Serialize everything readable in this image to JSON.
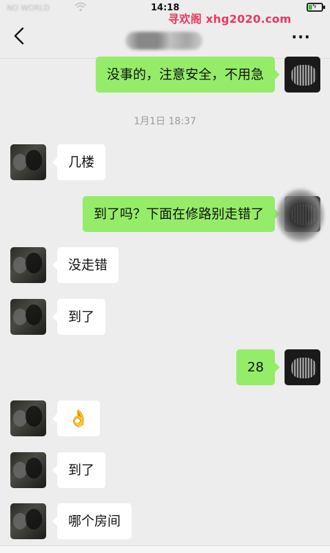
{
  "status_bar": {
    "carrier": "NO WORLD",
    "time": "14:18",
    "watermark": "寻欢阁 xhg2020.com",
    "battery_level": 0.3
  },
  "nav": {
    "back_icon": "chevron-left-icon",
    "more": "···"
  },
  "messages": [
    {
      "sender": "me",
      "text": "没事的，注意安全，不用急"
    },
    {
      "type": "time",
      "text": "1月1日 18:37"
    },
    {
      "sender": "friend",
      "text": "几楼"
    },
    {
      "sender": "me",
      "text": "到了吗？下面在修路别走错了"
    },
    {
      "sender": "friend",
      "text": "没走错"
    },
    {
      "sender": "friend",
      "text": "到了"
    },
    {
      "sender": "me",
      "text": "28"
    },
    {
      "sender": "friend",
      "text": "👌"
    },
    {
      "sender": "friend",
      "text": "到了"
    },
    {
      "sender": "friend",
      "text": "哪个房间"
    }
  ],
  "colors": {
    "background": "#ededed",
    "out_bubble": "#95ec69",
    "in_bubble": "#ffffff",
    "watermark": "#e8365e",
    "timestamp": "#9b9b9b"
  }
}
